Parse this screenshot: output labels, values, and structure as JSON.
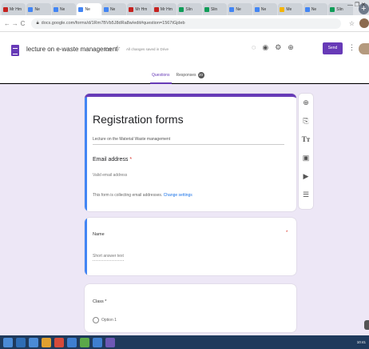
{
  "browser": {
    "tabs": [
      {
        "label": "Mr Hm",
        "color": "#c5221f",
        "active": false
      },
      {
        "label": "Ne",
        "color": "#4285f4",
        "active": false
      },
      {
        "label": "Ne",
        "color": "#4285f4",
        "active": false
      },
      {
        "label": "Ne",
        "color": "#4285f4",
        "active": true
      },
      {
        "label": "Ne",
        "color": "#4285f4",
        "active": false
      },
      {
        "label": "Mr Hm",
        "color": "#c5221f",
        "active": false
      },
      {
        "label": "Mr Hm",
        "color": "#c5221f",
        "active": false
      },
      {
        "label": "Slin",
        "color": "#0f9d58",
        "active": false
      },
      {
        "label": "Slin",
        "color": "#0f9d58",
        "active": false
      },
      {
        "label": "Ne",
        "color": "#4285f4",
        "active": false
      },
      {
        "label": "Ne",
        "color": "#4285f4",
        "active": false
      },
      {
        "label": "Me",
        "color": "#f4b400",
        "active": false
      },
      {
        "label": "Ne",
        "color": "#4285f4",
        "active": false
      },
      {
        "label": "Slin",
        "color": "#0f9d58",
        "active": false
      }
    ],
    "new_tab": "+",
    "url": "docs.google.com/forms/d/1Rm7BVb5J8dRa8w/edit#question=1567tGjdeb"
  },
  "forms": {
    "doc_title": "lecture on e-waste management",
    "saved_status": "All changes saved in Drive",
    "send_label": "Send",
    "tab_questions": "Questions",
    "tab_responses": "Responses",
    "responses_count": "20"
  },
  "form": {
    "title": "Registration forms",
    "description": "Lecture on the Material Waste management",
    "email_label": "Email address",
    "email_required": "*",
    "email_hint": "Valid email address",
    "collect_note": "This form is collecting email addresses.",
    "change_settings": "Change settings",
    "q1_label": "Name",
    "q1_required": "*",
    "q1_hint": "Short answer text",
    "q2_label": "Class",
    "q2_required": "*",
    "q2_option1": "Option 1"
  },
  "toolbar_icons": [
    "add-question-icon",
    "import-questions-icon",
    "add-title-icon",
    "add-image-icon",
    "add-video-icon",
    "add-section-icon"
  ],
  "taskbar": {
    "clock": "10:41"
  }
}
